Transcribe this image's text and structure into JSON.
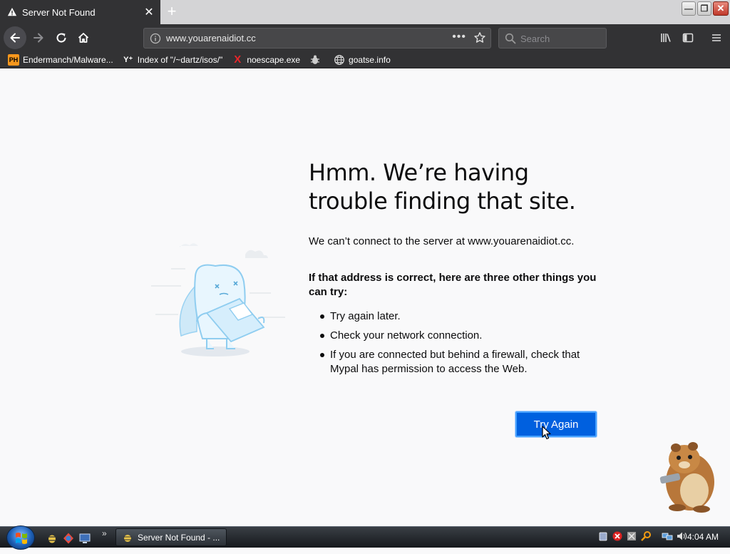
{
  "tab": {
    "title": "Server Not Found",
    "close_glyph": "✕",
    "new_tab_glyph": "+"
  },
  "window_controls": {
    "minimize": "—",
    "restore": "❐",
    "close": "✕"
  },
  "navbar": {
    "url": "www.youarenaidiot.cc",
    "more_glyph": "•••",
    "search_placeholder": "Search"
  },
  "bookmarks": [
    {
      "label": "Endermanch/Malware...",
      "icon": "ph-icon",
      "icon_text": "PH"
    },
    {
      "label": "Index of \"/~dartz/isos/\"",
      "icon": "yc-icon",
      "icon_text": "Y⁺"
    },
    {
      "label": "noescape.exe",
      "icon": "x-icon",
      "icon_text": "X"
    },
    {
      "label": "",
      "icon": "bug-icon",
      "icon_text": ""
    },
    {
      "label": "goatse.info",
      "icon": "globe-icon",
      "icon_text": ""
    }
  ],
  "error_page": {
    "heading": "Hmm. We’re having trouble finding that site.",
    "description": "We can’t connect to the server at www.youarenaidiot.cc.",
    "subheading": "If that address is correct, here are three other things you can try:",
    "tips": [
      "Try again later.",
      "Check your network connection.",
      "If you are connected but behind a firewall, check that Mypal has permission to access the Web."
    ],
    "button_label": "Try Again"
  },
  "taskbar": {
    "chevron": "»",
    "task_label": "Server Not Found - ...",
    "clock": "4:04 AM"
  },
  "colors": {
    "chrome_dark": "#323234",
    "page_bg": "#f9f9fa",
    "button_blue": "#0060df",
    "text": "#0c0c0d"
  }
}
